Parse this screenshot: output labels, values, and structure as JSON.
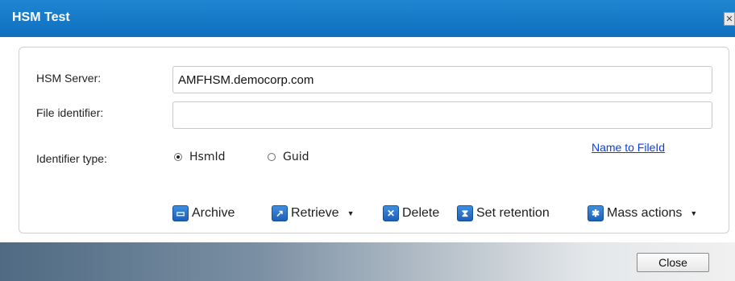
{
  "window": {
    "title": "HSM Test",
    "close_glyph": "✕"
  },
  "form": {
    "server_label": "HSM Server:",
    "server_value": "AMFHSM.democorp.com",
    "file_label": "File identifier:",
    "file_value": "",
    "type_label": "Identifier type:",
    "radios": [
      {
        "label": "HsmId",
        "selected": true
      },
      {
        "label": "Guid",
        "selected": false
      }
    ],
    "link_label": "Name to FileId"
  },
  "toolbar": {
    "archive_label": "Archive",
    "retrieve_label": "Retrieve",
    "delete_label": "Delete",
    "retention_label": "Set retention",
    "mass_label": "Mass actions"
  },
  "icons": {
    "archive": "archive-icon",
    "retrieve": "retrieve-icon",
    "delete": "delete-icon",
    "retention": "hourglass-icon",
    "mass": "gear-icon",
    "caret": "caret-down-icon"
  },
  "footer": {
    "close_label": "Close"
  },
  "colors": {
    "titlebar": "#0f6fbe",
    "link": "#0a3ee8",
    "icon_blue": "#1d5fb7"
  }
}
